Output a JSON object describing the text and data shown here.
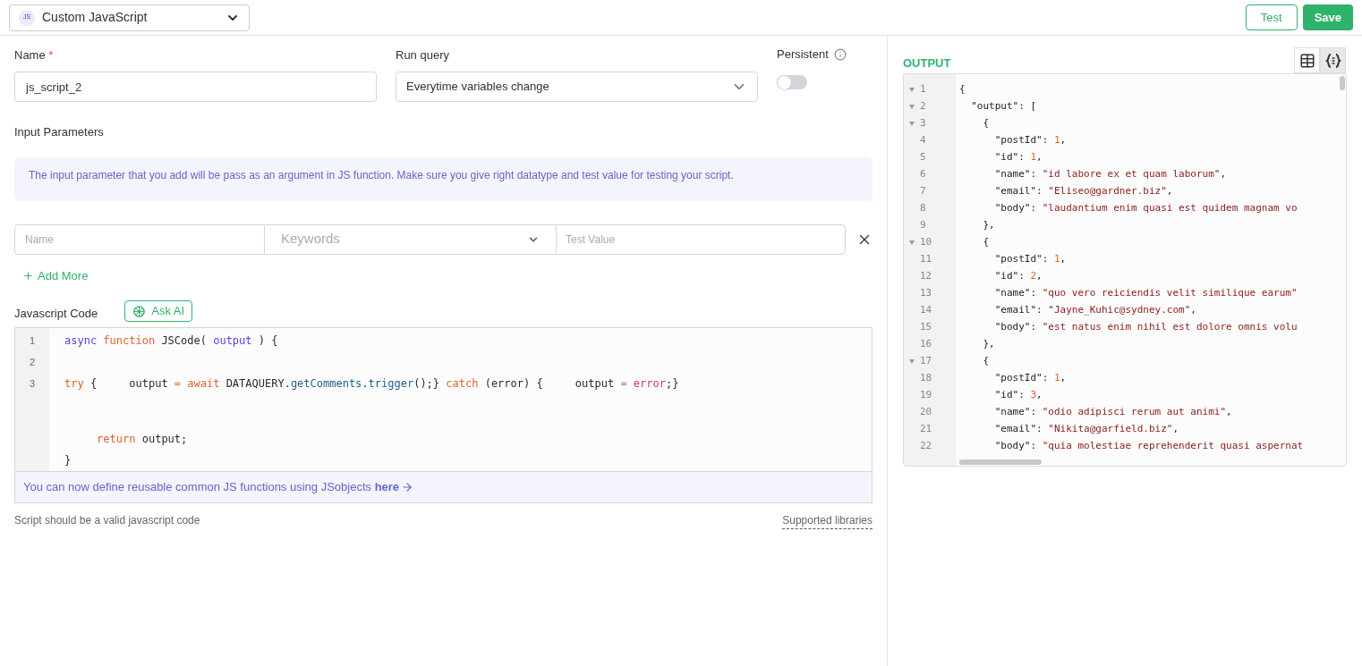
{
  "header": {
    "source": {
      "badge": "JS",
      "label": "Custom JavaScript"
    },
    "buttons": [
      {
        "label": "Test",
        "kind": "outline"
      },
      {
        "label": "Save",
        "kind": "primary"
      }
    ]
  },
  "form": {
    "name": {
      "label": "Name",
      "required_mark": "*",
      "value": "js_script_2"
    },
    "run_query": {
      "label": "Run query",
      "value": "Everytime variables change"
    },
    "persistent": {
      "label": "Persistent",
      "on": false
    },
    "input_parameters": {
      "title": "Input Parameters",
      "info": "The input parameter that you add will be pass as an argument in JS function. Make sure you give right datatype and test value for testing your script.",
      "row": {
        "name_placeholder": "Name",
        "type_placeholder": "Keywords",
        "value_placeholder": "Test Value"
      },
      "add_more": "Add More"
    },
    "code": {
      "label": "Javascript Code",
      "ask_ai": "Ask AI",
      "lines": [
        {
          "number": "1",
          "tokens": [
            {
              "text": "async ",
              "kind": "kw"
            },
            {
              "text": "function ",
              "kind": "fn"
            },
            {
              "text": "JSCode( ",
              "kind": "plain"
            },
            {
              "text": "output",
              "kind": "kw"
            },
            {
              "text": " ) {",
              "kind": "plain"
            }
          ]
        },
        {
          "number": "2"
        },
        {
          "number": "3",
          "tokens": [
            {
              "text": "try ",
              "kind": "fn"
            },
            {
              "text": "{     output ",
              "kind": "plain"
            },
            {
              "text": "= await ",
              "kind": "fn"
            },
            {
              "text": "DATAQUERY.",
              "kind": "plain"
            },
            {
              "text": "getComments",
              "kind": "prop"
            },
            {
              "text": ".",
              "kind": "plain"
            },
            {
              "text": "trigger",
              "kind": "prop"
            },
            {
              "text": "();} ",
              "kind": "plain"
            },
            {
              "text": "catch ",
              "kind": "fn"
            },
            {
              "text": "(error) {     output ",
              "kind": "plain"
            },
            {
              "text": "= ",
              "kind": "fn"
            },
            {
              "text": "error",
              "kind": "err"
            },
            {
              "text": ";}",
              "kind": "plain"
            }
          ]
        },
        {
          "blank": true
        },
        {
          "tokens": [
            {
              "text": "     return ",
              "kind": "fn"
            },
            {
              "text": "output;",
              "kind": "plain"
            }
          ]
        },
        {
          "tokens": [
            {
              "text": "}",
              "kind": "plain"
            }
          ]
        }
      ],
      "hint": "You can now define reusable common JS functions using JSobjects **here**",
      "footer": "Script should be a valid javascript code",
      "libraries_link": "Supported libraries"
    }
  },
  "output": {
    "title": "OUTPUT",
    "views": [
      {
        "kind": "table",
        "selected": false
      },
      {
        "kind": "json",
        "selected": true
      }
    ],
    "lines": [
      {
        "number": "1",
        "fold": true,
        "tokens": [
          {
            "text": "{",
            "kind": "punct"
          }
        ]
      },
      {
        "number": "2",
        "fold": true,
        "tokens": [
          {
            "text": "  \"output\"",
            "kind": "key"
          },
          {
            "text": ": [",
            "kind": "punct"
          }
        ]
      },
      {
        "number": "3",
        "fold": true,
        "tokens": [
          {
            "text": "    {",
            "kind": "punct"
          }
        ]
      },
      {
        "number": "4",
        "fold": false,
        "tokens": [
          {
            "text": "      \"postId\"",
            "kind": "key"
          },
          {
            "text": ": ",
            "kind": "punct"
          },
          {
            "text": "1",
            "kind": "num"
          },
          {
            "text": ",",
            "kind": "punct"
          }
        ]
      },
      {
        "number": "5",
        "fold": false,
        "tokens": [
          {
            "text": "      \"id\"",
            "kind": "key"
          },
          {
            "text": ": ",
            "kind": "punct"
          },
          {
            "text": "1",
            "kind": "num"
          },
          {
            "text": ",",
            "kind": "punct"
          }
        ]
      },
      {
        "number": "6",
        "fold": false,
        "tokens": [
          {
            "text": "      \"name\"",
            "kind": "key"
          },
          {
            "text": ": ",
            "kind": "punct"
          },
          {
            "text": "\"id labore ex et quam laborum\"",
            "kind": "str"
          },
          {
            "text": ",",
            "kind": "punct"
          }
        ]
      },
      {
        "number": "7",
        "fold": false,
        "tokens": [
          {
            "text": "      \"email\"",
            "kind": "key"
          },
          {
            "text": ": ",
            "kind": "punct"
          },
          {
            "text": "\"Eliseo@gardner.biz\"",
            "kind": "str"
          },
          {
            "text": ",",
            "kind": "punct"
          }
        ]
      },
      {
        "number": "8",
        "fold": false,
        "tokens": [
          {
            "text": "      \"body\"",
            "kind": "key"
          },
          {
            "text": ": ",
            "kind": "punct"
          },
          {
            "text": "\"laudantium enim quasi est quidem magnam vo",
            "kind": "str"
          }
        ]
      },
      {
        "number": "9",
        "fold": false,
        "tokens": [
          {
            "text": "    },",
            "kind": "punct"
          }
        ]
      },
      {
        "number": "10",
        "fold": true,
        "tokens": [
          {
            "text": "    {",
            "kind": "punct"
          }
        ]
      },
      {
        "number": "11",
        "fold": false,
        "tokens": [
          {
            "text": "      \"postId\"",
            "kind": "key"
          },
          {
            "text": ": ",
            "kind": "punct"
          },
          {
            "text": "1",
            "kind": "num"
          },
          {
            "text": ",",
            "kind": "punct"
          }
        ]
      },
      {
        "number": "12",
        "fold": false,
        "tokens": [
          {
            "text": "      \"id\"",
            "kind": "key"
          },
          {
            "text": ": ",
            "kind": "punct"
          },
          {
            "text": "2",
            "kind": "num"
          },
          {
            "text": ",",
            "kind": "punct"
          }
        ]
      },
      {
        "number": "13",
        "fold": false,
        "tokens": [
          {
            "text": "      \"name\"",
            "kind": "key"
          },
          {
            "text": ": ",
            "kind": "punct"
          },
          {
            "text": "\"quo vero reiciendis velit similique earum\"",
            "kind": "str"
          }
        ]
      },
      {
        "number": "14",
        "fold": false,
        "tokens": [
          {
            "text": "      \"email\"",
            "kind": "key"
          },
          {
            "text": ": ",
            "kind": "punct"
          },
          {
            "text": "\"Jayne_Kuhic@sydney.com\"",
            "kind": "str"
          },
          {
            "text": ",",
            "kind": "punct"
          }
        ]
      },
      {
        "number": "15",
        "fold": false,
        "tokens": [
          {
            "text": "      \"body\"",
            "kind": "key"
          },
          {
            "text": ": ",
            "kind": "punct"
          },
          {
            "text": "\"est natus enim nihil est dolore omnis volu",
            "kind": "str"
          }
        ]
      },
      {
        "number": "16",
        "fold": false,
        "tokens": [
          {
            "text": "    },",
            "kind": "punct"
          }
        ]
      },
      {
        "number": "17",
        "fold": true,
        "tokens": [
          {
            "text": "    {",
            "kind": "punct"
          }
        ]
      },
      {
        "number": "18",
        "fold": false,
        "tokens": [
          {
            "text": "      \"postId\"",
            "kind": "key"
          },
          {
            "text": ": ",
            "kind": "punct"
          },
          {
            "text": "1",
            "kind": "num"
          },
          {
            "text": ",",
            "kind": "punct"
          }
        ]
      },
      {
        "number": "19",
        "fold": false,
        "tokens": [
          {
            "text": "      \"id\"",
            "kind": "key"
          },
          {
            "text": ": ",
            "kind": "punct"
          },
          {
            "text": "3",
            "kind": "num"
          },
          {
            "text": ",",
            "kind": "punct"
          }
        ]
      },
      {
        "number": "20",
        "fold": false,
        "tokens": [
          {
            "text": "      \"name\"",
            "kind": "key"
          },
          {
            "text": ": ",
            "kind": "punct"
          },
          {
            "text": "\"odio adipisci rerum aut animi\"",
            "kind": "str"
          },
          {
            "text": ",",
            "kind": "punct"
          }
        ]
      },
      {
        "number": "21",
        "fold": false,
        "tokens": [
          {
            "text": "      \"email\"",
            "kind": "key"
          },
          {
            "text": ": ",
            "kind": "punct"
          },
          {
            "text": "\"Nikita@garfield.biz\"",
            "kind": "str"
          },
          {
            "text": ",",
            "kind": "punct"
          }
        ]
      },
      {
        "number": "22",
        "fold": false,
        "tokens": [
          {
            "text": "      \"body\"",
            "kind": "key"
          },
          {
            "text": ": ",
            "kind": "punct"
          },
          {
            "text": "\"quia molestiae reprehenderit quasi aspernat",
            "kind": "str"
          }
        ]
      }
    ]
  }
}
